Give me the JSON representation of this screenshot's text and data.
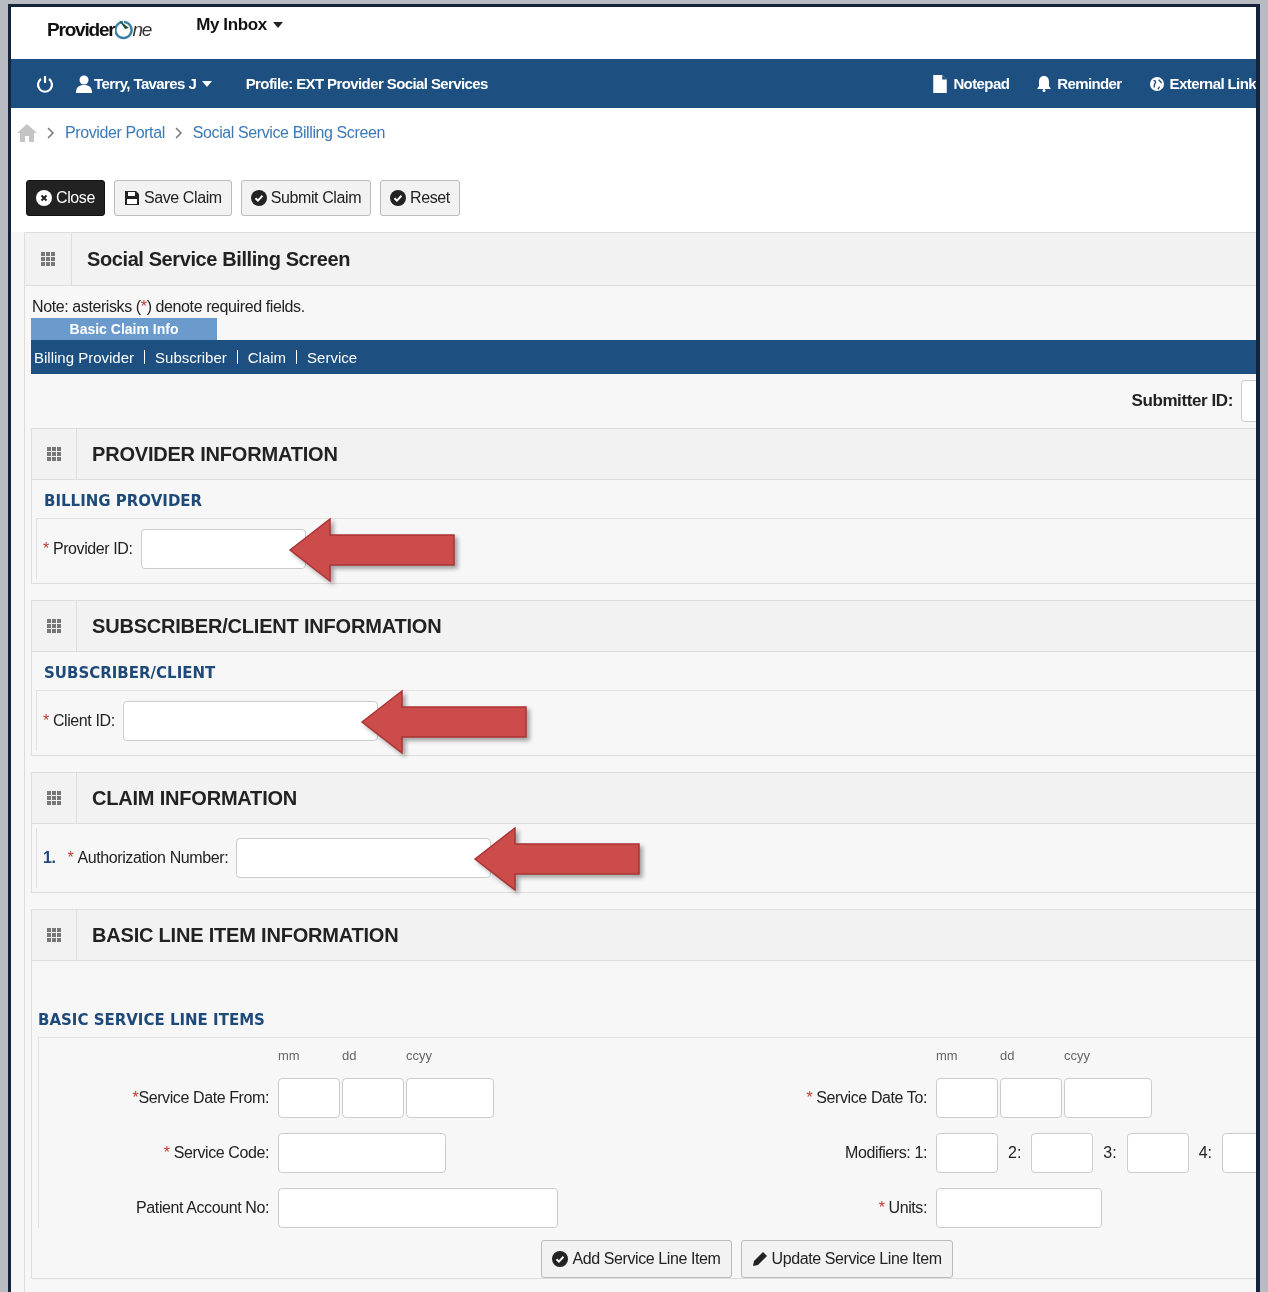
{
  "header": {
    "logo": {
      "before": "Provider",
      "after": "ne"
    },
    "menu": "My Inbox"
  },
  "navbar": {
    "user": "Terry, Tavares J",
    "profile": "Profile: EXT Provider Social Services",
    "links": [
      {
        "label": "Notepad"
      },
      {
        "label": "Reminder"
      },
      {
        "label": "External Link"
      }
    ]
  },
  "breadcrumb": [
    "Provider Portal",
    "Social Service Billing Screen"
  ],
  "toolbar": [
    {
      "label": "Close",
      "kind": "primary"
    },
    {
      "label": "Save Claim",
      "kind": "default"
    },
    {
      "label": "Submit Claim",
      "kind": "default"
    },
    {
      "label": "Reset",
      "kind": "default"
    }
  ],
  "panel": {
    "title": "Social Service Billing Screen",
    "note": {
      "before": "Note: asterisks (",
      "mark": "*",
      "after": ") denote required fields."
    },
    "tab": "Basic Claim Info",
    "subnav": [
      "Billing Provider",
      "Subscriber",
      "Claim",
      "Service"
    ],
    "submitter_label": "Submitter ID:"
  },
  "sections": [
    {
      "title": "PROVIDER INFORMATION",
      "subtitle": "BILLING PROVIDER",
      "fields": [
        {
          "label": "Provider ID:",
          "required": true,
          "annotated": true
        }
      ]
    },
    {
      "title": "SUBSCRIBER/CLIENT INFORMATION",
      "subtitle": "SUBSCRIBER/CLIENT",
      "fields": [
        {
          "label": "Client ID:",
          "required": true,
          "annotated": true
        }
      ]
    },
    {
      "title": "CLAIM INFORMATION",
      "fields": [
        {
          "number": "1.",
          "label": "Authorization Number:",
          "required": true,
          "annotated": true
        }
      ]
    }
  ],
  "line_items": {
    "title": "BASIC LINE ITEM INFORMATION",
    "subtitle": "BASIC SERVICE LINE ITEMS",
    "left": [
      {
        "kind": "date",
        "label": "Service Date From:",
        "required": true,
        "parts": [
          "mm",
          "dd",
          "ccyy"
        ]
      },
      {
        "kind": "text",
        "label": "Service Code:",
        "required": true
      },
      {
        "kind": "text",
        "label": "Patient Account No:",
        "required": false
      }
    ],
    "right": [
      {
        "kind": "date",
        "label": "Service Date To:",
        "required": true,
        "parts": [
          "mm",
          "dd",
          "ccyy"
        ]
      },
      {
        "kind": "modifiers",
        "label": "Modifiers: 1:",
        "required": false,
        "parts": [
          "2:",
          "3:",
          "4:"
        ]
      },
      {
        "kind": "text",
        "label": "Units:",
        "required": true
      }
    ],
    "buttons": [
      {
        "label": "Add Service Line Item"
      },
      {
        "label": "Update Service Line Item"
      }
    ]
  }
}
